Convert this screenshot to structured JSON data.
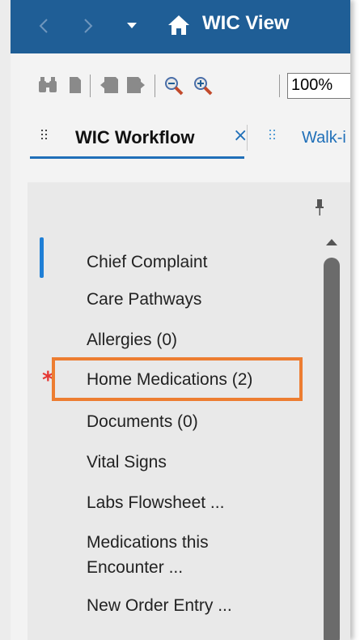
{
  "window": {
    "title": "WIC View",
    "nav": {
      "back": "back-arrow-icon",
      "forward": "forward-arrow-icon",
      "dropdown": "chevron-down-icon",
      "home": "home-icon"
    },
    "accent": "#1f5e96"
  },
  "toolbar": {
    "icons": [
      "binoculars-icon",
      "page-icon",
      "page-back-icon",
      "page-forward-icon",
      "zoom-out-icon",
      "zoom-in-icon"
    ],
    "zoom": "100%"
  },
  "tabs": [
    {
      "label": "WIC Workflow",
      "active": true,
      "close": "×"
    },
    {
      "label": "Walk-i",
      "active": false
    }
  ],
  "sidebar": {
    "items": [
      {
        "label": "Chief Complaint"
      },
      {
        "label": "Care Pathways"
      },
      {
        "label": "Allergies (0)"
      },
      {
        "label": "Home Medications (2)",
        "required": true,
        "highlighted": true
      },
      {
        "label": "Documents (0)"
      },
      {
        "label": "Vital Signs"
      },
      {
        "label": "Labs Flowsheet ..."
      },
      {
        "label": "Medications this Encounter ..."
      },
      {
        "label": "New Order Entry ..."
      }
    ],
    "required_marker": "*",
    "highlight_color": "#ed7d31",
    "indicator_color": "#1f7fd6"
  }
}
